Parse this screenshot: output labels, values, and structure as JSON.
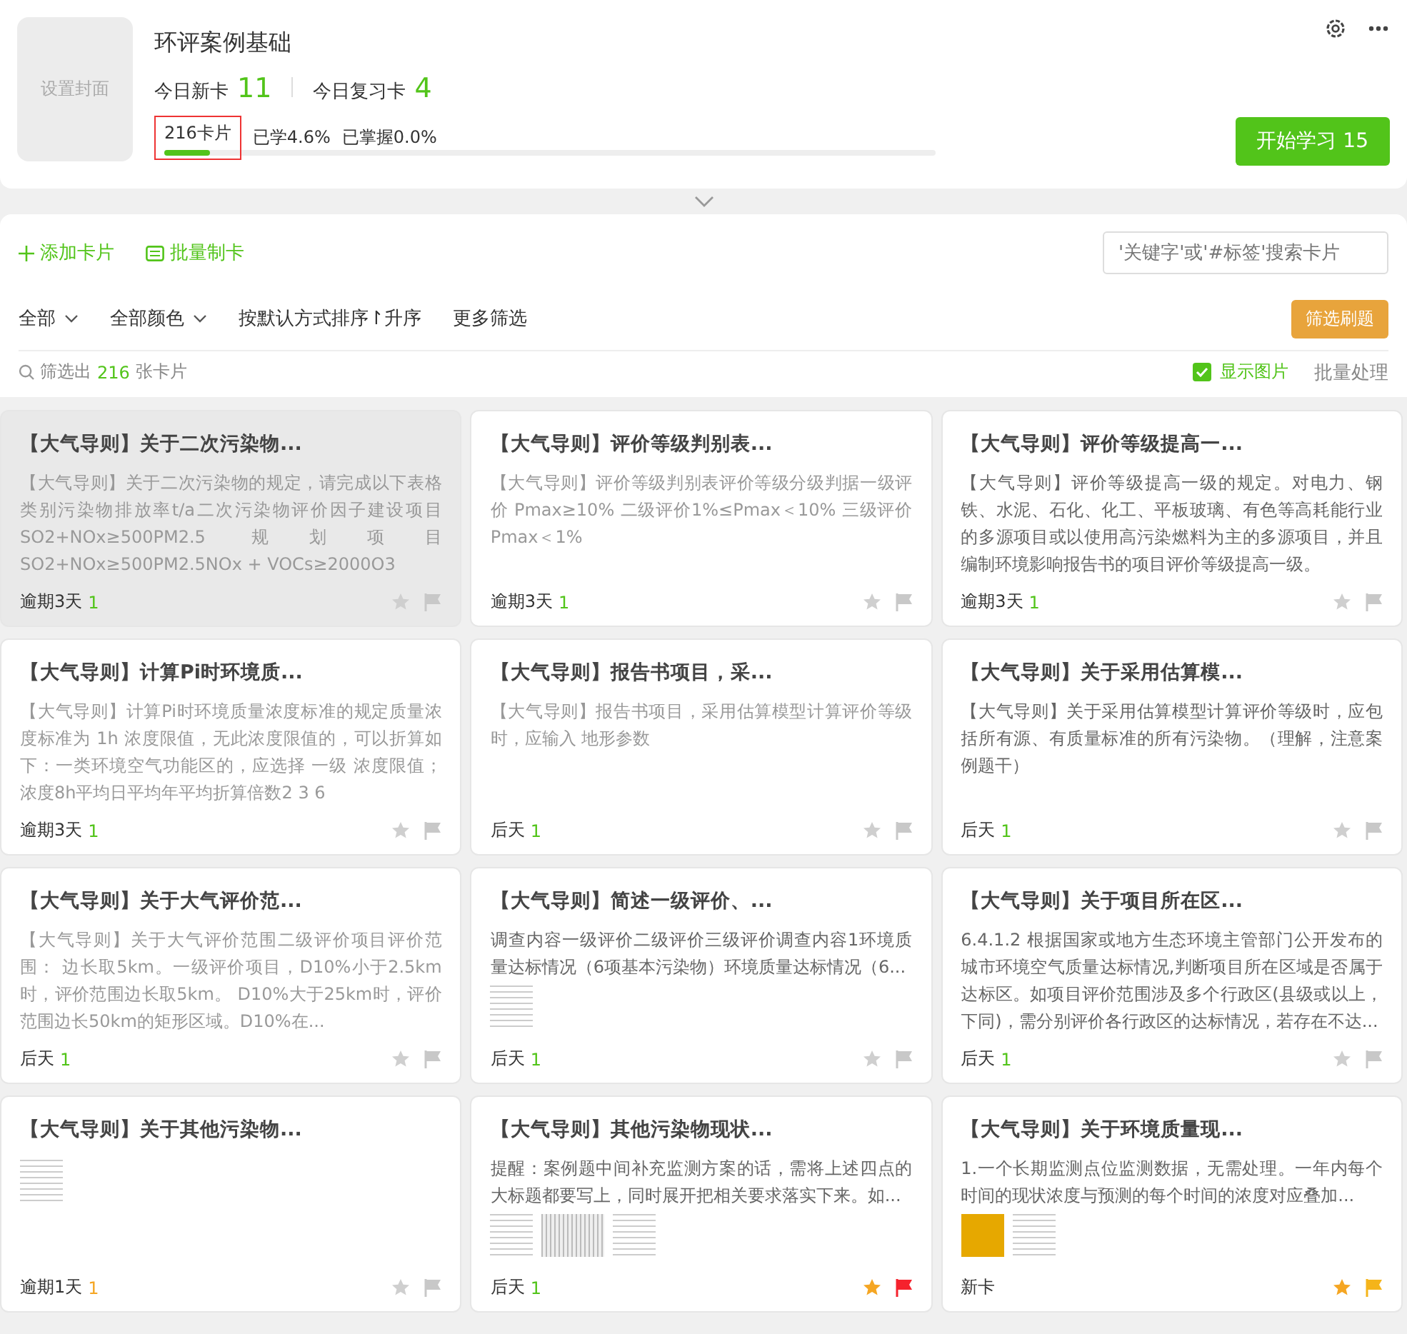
{
  "deck": {
    "cover_label": "设置封面",
    "title": "环评案例基础",
    "new_label": "今日新卡",
    "new_count": "11",
    "review_label": "今日复习卡",
    "review_count": "4",
    "total": "216卡片",
    "learned": "已学4.6%",
    "mastered": "已掌握0.0%",
    "level": 0.06,
    "start_button": "开始学习 15"
  },
  "toolbar": {
    "add_card": "添加卡片",
    "batch_create": "批量制卡",
    "search": {
      "placeholder": "'关键字'或'#标签'搜索卡片"
    },
    "filters": [
      {
        "label": "全部",
        "kind": "dropdown"
      },
      {
        "label": "全部颜色",
        "kind": "dropdown"
      },
      {
        "label": "按默认方式排序↾升序",
        "kind": "plain"
      },
      {
        "label": "更多筛选",
        "kind": "plain"
      }
    ],
    "filter_button": "筛选刷题",
    "result_prefix": "筛选出",
    "result_count": "216",
    "result_suffix": "张卡片",
    "show_images": {
      "label": "显示图片",
      "checked": true
    },
    "batch": "批量处理"
  },
  "cards": [
    {
      "title": "【大气导则】关于二次污染物...",
      "body": "【大气导则】关于二次污染物的规定，请完成以下表格类别污染物排放率t/a二次污染物评价因子建设项目SO2+NOx≥500PM2.5 规划项目 SO2+NOx≥500PM2.5NOx + VOCs≥2000O3",
      "dimmed": true,
      "due": "逾期3天",
      "count": {
        "text": "1",
        "color": "#52c41a"
      },
      "starred": false,
      "highlighted": true
    },
    {
      "title": "【大气导则】评价等级判别表...",
      "body": "【大气导则】评价等级判别表评价等级分级判据一级评价 Pmax≥10% 二级评价1%≤Pmax＜10% 三级评价 Pmax＜1%",
      "dimmed": true,
      "due": "逾期3天",
      "count": {
        "text": "1",
        "color": "#52c41a"
      },
      "starred": false,
      "highlighted": false
    },
    {
      "title": "【大气导则】评价等级提高一...",
      "body": "【大气导则】评价等级提高一级的规定。对电力、钢铁、水泥、石化、化工、平板玻璃、有色等高耗能行业的多源项目或以使用高污染燃料为主的多源项目，并且编制环境影响报告书的项目评价等级提高一级。",
      "dimmed": false,
      "due": "逾期3天",
      "count": {
        "text": "1",
        "color": "#52c41a"
      },
      "starred": false,
      "highlighted": false
    },
    {
      "title": "【大气导则】计算Pi时环境质...",
      "body": "【大气导则】计算Pi时环境质量浓度标准的规定质量浓度标准为 1h 浓度限值，无此浓度限值的，可以折算如下：一类环境空气功能区的，应选择 一级 浓度限值；浓度8h平均日平均年平均折算倍数2 3 6",
      "dimmed": true,
      "due": "逾期3天",
      "count": {
        "text": "1",
        "color": "#52c41a"
      },
      "starred": false,
      "highlighted": false
    },
    {
      "title": "【大气导则】报告书项目，采...",
      "body": "【大气导则】报告书项目，采用估算模型计算评价等级时，应输入 地形参数",
      "dimmed": true,
      "due": "后天",
      "count": {
        "text": "1",
        "color": "#52c41a"
      },
      "starred": false,
      "highlighted": false
    },
    {
      "title": "【大气导则】关于采用估算模...",
      "body": "【大气导则】关于采用估算模型计算评价等级时，应包括所有源、有质量标准的所有污染物。（理解，注意案例题干）",
      "dimmed": false,
      "due": "后天",
      "count": {
        "text": "1",
        "color": "#52c41a"
      },
      "starred": false,
      "highlighted": false
    },
    {
      "title": "【大气导则】关于大气评价范...",
      "body": "【大气导则】关于大气评价范围二级评价项目评价范围： 边长取5km。一级评价项目，D10%小于2.5km时，评价范围边长取5km。 D10%大于25km时，评价范围边长50km的矩形区域。D10%在...",
      "dimmed": true,
      "due": "后天",
      "count": {
        "text": "1",
        "color": "#52c41a"
      },
      "starred": false,
      "highlighted": false
    },
    {
      "title": "【大气导则】简述一级评价、...",
      "body": "调查内容一级评价二级评价三级评价调查内容1环境质量达标情况（6项基本污染物）环境质量达标情况（6...",
      "dimmed": false,
      "images": [
        {
          "kind": "document"
        }
      ],
      "due": "后天",
      "count": {
        "text": "1",
        "color": "#52c41a"
      },
      "starred": false,
      "highlighted": false
    },
    {
      "title": "【大气导则】关于项目所在区...",
      "body": "6.4.1.2 根据国家或地方生态环境主管部门公开发布的城市环境空气质量达标情况,判断项目所在区域是否属于达标区。如项目评价范围涉及多个行政区(县级或以上，下同)，需分别评价各行政区的达标情况，若存在不达...",
      "dimmed": false,
      "due": "后天",
      "count": {
        "text": "1",
        "color": "#52c41a"
      },
      "starred": false,
      "highlighted": false
    },
    {
      "title": "【大气导则】关于其他污染物...",
      "images": [
        {
          "kind": "document"
        }
      ],
      "due": "逾期1天",
      "count": {
        "text": "1",
        "color": "#f5a623"
      },
      "starred": false,
      "highlighted": false
    },
    {
      "title": "【大气导则】其他污染物现状...",
      "body": "提醒：案例题中间补充监测方案的话，需将上述四点的大标题都要写上，同时展开把相关要求落实下来。如...",
      "dimmed": false,
      "images": [
        {
          "kind": "document"
        },
        {
          "kind": "chart"
        },
        {
          "kind": "document"
        }
      ],
      "due": "后天",
      "count": {
        "text": "1",
        "color": "#52c41a"
      },
      "starred": true,
      "flag": {
        "color": "#f5222d"
      },
      "highlighted": false
    },
    {
      "title": "【大气导则】关于环境质量现...",
      "body": "1.一个长期监测点位监测数据，无需处理。一年内每个时间的现状浓度与预测的每个时间的浓度对应叠加...",
      "dimmed": false,
      "images": [
        {
          "kind": "photo"
        },
        {
          "kind": "document"
        }
      ],
      "due": "新卡",
      "starred": true,
      "flag": {
        "color": "#f5b41a"
      },
      "highlighted": false
    }
  ]
}
